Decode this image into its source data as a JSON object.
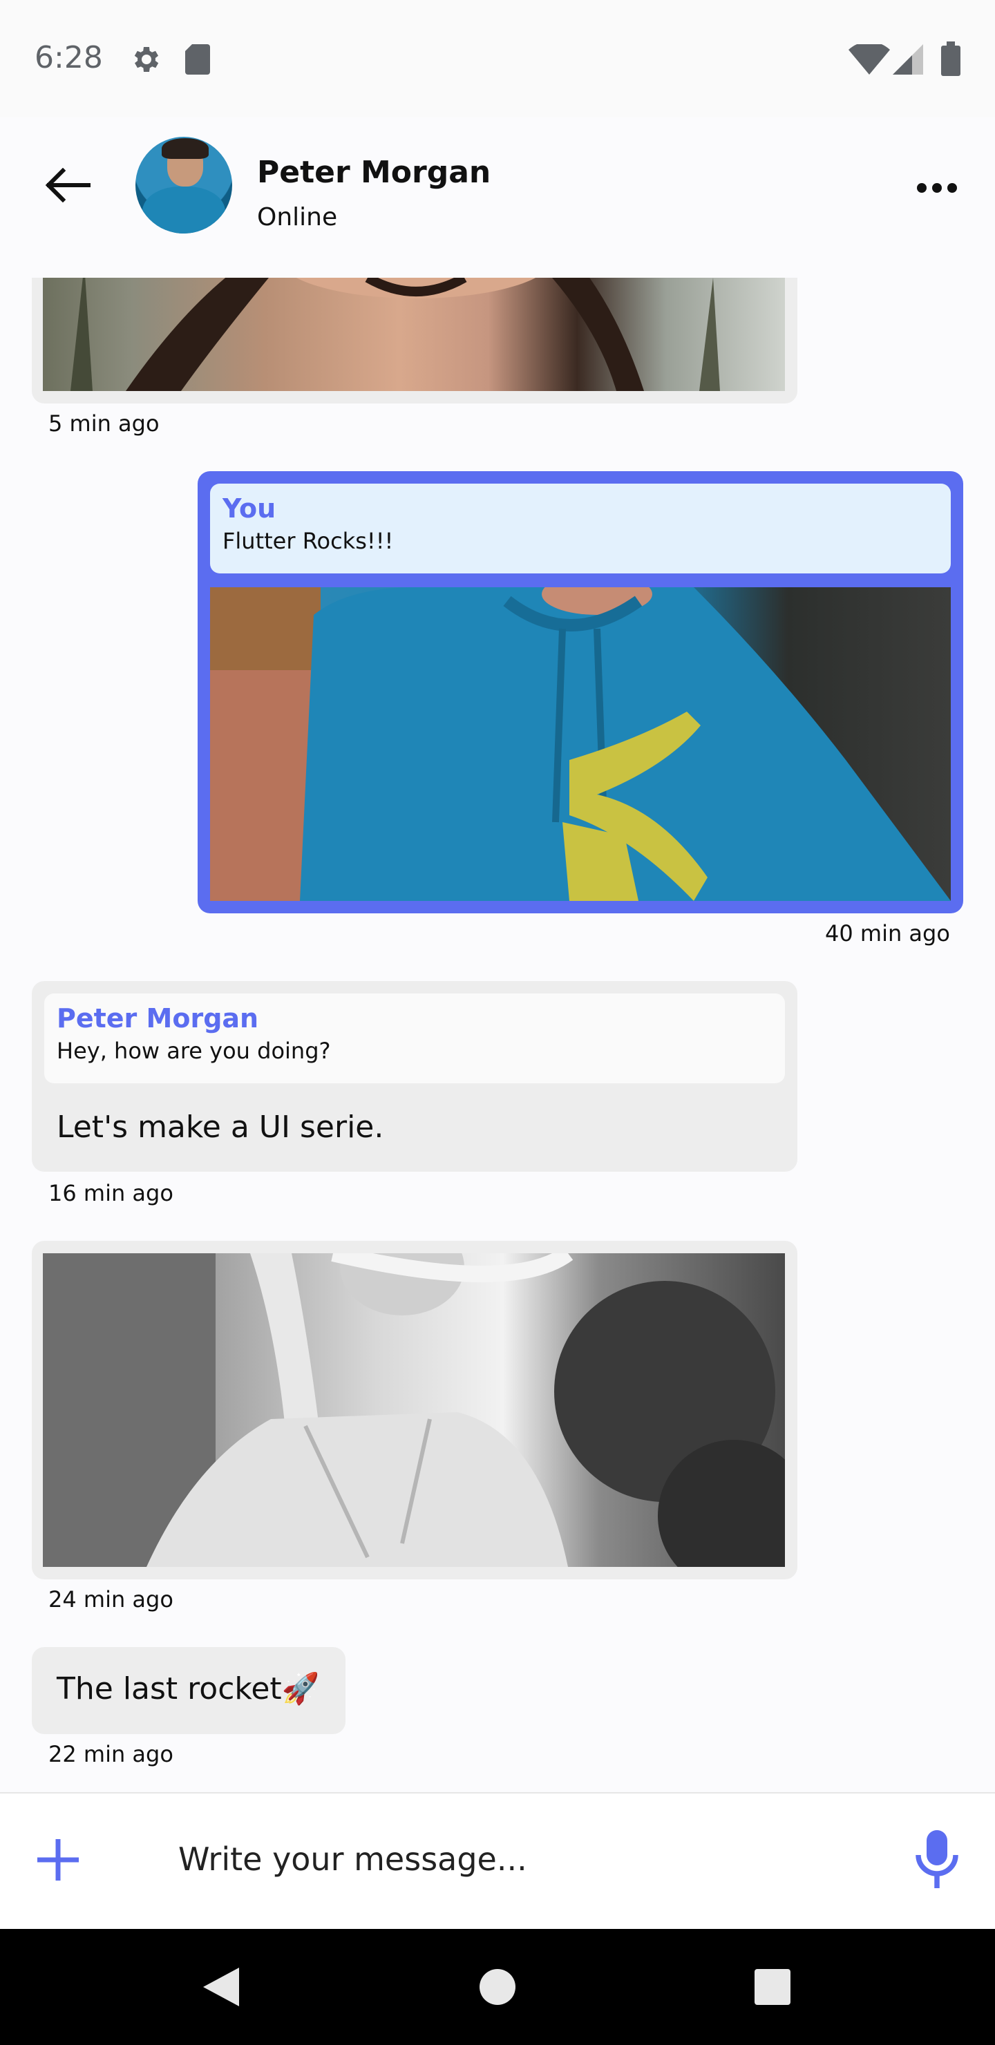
{
  "status_bar": {
    "time": "6:28",
    "icons": [
      "gear-icon",
      "sd-card-icon",
      "wifi-icon",
      "cell-signal-icon",
      "battery-icon"
    ]
  },
  "header": {
    "contact_name": "Peter Morgan",
    "contact_status": "Online",
    "icons": [
      "back-arrow-icon",
      "more-dots-icon"
    ]
  },
  "messages": [
    {
      "type": "image",
      "direction": "received",
      "time": "5 min ago",
      "image_desc": "smiling woman with palm trees"
    },
    {
      "type": "image-reply",
      "direction": "sent",
      "reply_author": "You",
      "reply_text": "Flutter Rocks!!!",
      "time": "40 min ago",
      "image_desc": "person in blue Puma hoodie"
    },
    {
      "type": "text-reply",
      "direction": "received",
      "reply_author": "Peter Morgan",
      "reply_text": "Hey, how are you doing?",
      "text": "Let's make a UI serie.",
      "time": "16 min ago"
    },
    {
      "type": "image",
      "direction": "received",
      "time": "24 min ago",
      "image_desc": "black and white woman with windblown hair"
    },
    {
      "type": "text",
      "direction": "received",
      "text": "The last rocket🚀",
      "time": "22 min ago"
    }
  ],
  "input": {
    "placeholder": "Write your message...",
    "icons": [
      "plus-icon",
      "microphone-icon"
    ]
  },
  "nav_bar": {
    "icons": [
      "nav-back-icon",
      "nav-home-icon",
      "nav-recents-icon"
    ]
  },
  "colors": {
    "accent": "#5b6df0",
    "received_bubble": "#ededed",
    "sent_reply_background": "#e3f1fd",
    "received_reply_background": "#fafafa",
    "background": "#fbfbfd"
  }
}
